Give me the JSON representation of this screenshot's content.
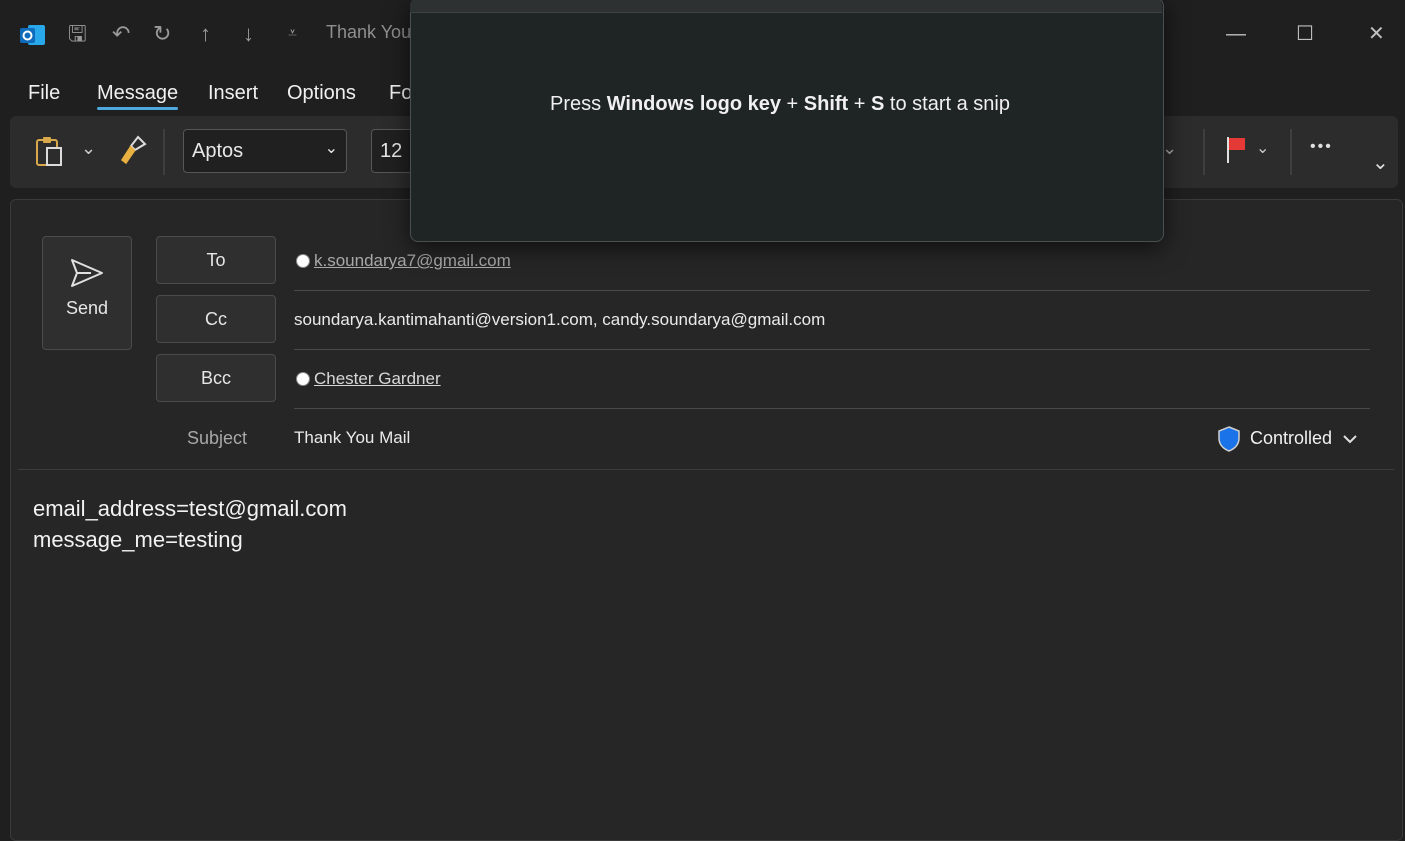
{
  "window": {
    "title": "Thank You",
    "minimize": "—",
    "maximize": "☐",
    "close": "✕"
  },
  "quick_access": {
    "save": "🖫",
    "undo": "↶",
    "redo": "↻",
    "up": "↑",
    "down": "↓",
    "customize": "⩡"
  },
  "menu": {
    "items": [
      "File",
      "Message",
      "Insert",
      "Options",
      "Fo"
    ]
  },
  "ribbon": {
    "font_name": "Aptos",
    "font_size": "12",
    "more": "•••",
    "expand": "⌄",
    "chevron": "⌄"
  },
  "compose": {
    "send_label": "Send",
    "to_label": "To",
    "cc_label": "Cc",
    "bcc_label": "Bcc",
    "subject_label": "Subject",
    "to_value": "k.soundarya7@gmail.com",
    "cc_value": "soundarya.kantimahanti@version1.com, candy.soundarya@gmail.com",
    "bcc_value": "Chester Gardner",
    "subject_value": "Thank You Mail",
    "sensitivity": "Controlled",
    "body_lines": [
      "email_address=test@gmail.com",
      "message_me=testing"
    ]
  },
  "snip": {
    "pre": "Press ",
    "key1": "Windows logo key",
    "plus1": " + ",
    "key2": "Shift",
    "plus2": " + ",
    "key3": "S",
    "post": " to start a snip"
  },
  "colors": {
    "accent": "#4ea8de",
    "shield": "#1a73e8",
    "flag": "#e53935"
  }
}
